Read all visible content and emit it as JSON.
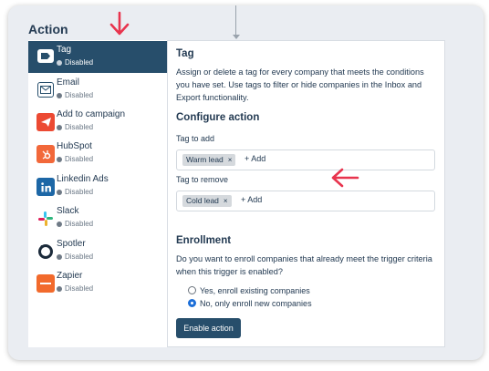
{
  "section": {
    "title": "Action"
  },
  "sidebar": {
    "items": [
      {
        "label": "Tag",
        "status": "Disabled",
        "icon": "tag-icon",
        "active": true
      },
      {
        "label": "Email",
        "status": "Disabled",
        "icon": "email-icon"
      },
      {
        "label": "Add to campaign",
        "status": "Disabled",
        "icon": "paper-plane-icon"
      },
      {
        "label": "HubSpot",
        "status": "Disabled",
        "icon": "hubspot-icon"
      },
      {
        "label": "Linkedin Ads",
        "status": "Disabled",
        "icon": "linkedin-icon"
      },
      {
        "label": "Slack",
        "status": "Disabled",
        "icon": "slack-icon"
      },
      {
        "label": "Spotler",
        "status": "Disabled",
        "icon": "spotler-icon"
      },
      {
        "label": "Zapier",
        "status": "Disabled",
        "icon": "zapier-icon"
      }
    ]
  },
  "main": {
    "title": "Tag",
    "description": "Assign or delete a tag for every company that meets the conditions you have set. Use tags to filter or hide companies in the Inbox and Export functionality.",
    "configure_title": "Configure action",
    "tag_add": {
      "label": "Tag to add",
      "chip": "Warm lead",
      "chip_remove": "×",
      "add": "+ Add"
    },
    "tag_remove": {
      "label": "Tag to remove",
      "chip": "Cold lead",
      "chip_remove": "×",
      "add": "+ Add"
    },
    "enrollment": {
      "title": "Enrollment",
      "question": "Do you want to enroll companies that already meet the trigger criteria when this trigger is enabled?",
      "options": [
        {
          "label": "Yes, enroll existing companies",
          "selected": false
        },
        {
          "label": "No, only enroll new companies",
          "selected": true
        }
      ]
    },
    "enable_button": "Enable action"
  },
  "colors": {
    "accent": "#274e6b",
    "annotation_red": "#e8344e"
  }
}
